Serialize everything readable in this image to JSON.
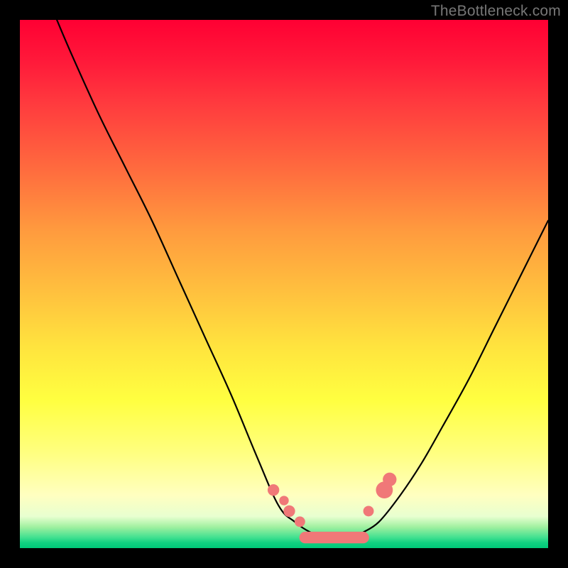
{
  "watermark": "TheBottleneck.com",
  "chart_data": {
    "type": "line",
    "title": "",
    "xlabel": "",
    "ylabel": "",
    "xlim": [
      0,
      100
    ],
    "ylim": [
      0,
      100
    ],
    "legend": null,
    "annotations": [],
    "series": [
      {
        "name": "left-curve",
        "x": [
          7,
          10,
          15,
          20,
          25,
          30,
          35,
          40,
          45,
          49,
          52,
          55,
          58
        ],
        "y": [
          100,
          93,
          82,
          72,
          62,
          51,
          40,
          29,
          17,
          8,
          5,
          3,
          2
        ]
      },
      {
        "name": "right-curve",
        "x": [
          65,
          68,
          72,
          76,
          80,
          85,
          90,
          95,
          100
        ],
        "y": [
          3,
          5,
          10,
          16,
          23,
          32,
          42,
          52,
          62
        ]
      }
    ],
    "markers": [
      {
        "name": "left-dot-1",
        "x": 48,
        "y": 11,
        "r": 1.1,
        "color": "#f07878"
      },
      {
        "name": "left-dot-2",
        "x": 51,
        "y": 7,
        "r": 1.1,
        "color": "#f07878"
      },
      {
        "name": "left-dot-3",
        "x": 50,
        "y": 9,
        "r": 0.9,
        "color": "#f07878"
      },
      {
        "name": "left-dot-4",
        "x": 53,
        "y": 5,
        "r": 1.0,
        "color": "#f07878"
      },
      {
        "name": "right-dot-1",
        "x": 66,
        "y": 7,
        "r": 1.0,
        "color": "#f07878"
      },
      {
        "name": "right-blob-hi",
        "x": 69,
        "y": 11,
        "r": 1.6,
        "color": "#f07878"
      },
      {
        "name": "right-blob-hi2",
        "x": 70,
        "y": 13,
        "r": 1.3,
        "color": "#f07878"
      }
    ],
    "plateau": {
      "name": "bottom-plateau",
      "x0": 54,
      "x1": 65,
      "y": 2,
      "thickness": 2.2,
      "color": "#f07878"
    },
    "background_gradient": {
      "top": "#ff0033",
      "mid": "#ffff40",
      "bottom": "#00c878"
    }
  }
}
